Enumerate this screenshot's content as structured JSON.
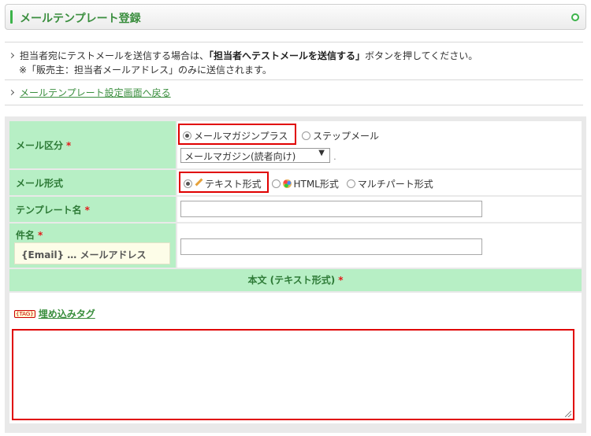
{
  "header": {
    "title": "メールテンプレート登録"
  },
  "notice": {
    "line1_pre": "担当者宛にテストメールを送信する場合は、",
    "line1_bold": "「担当者へテストメールを送信する」",
    "line1_post": "ボタンを押してください。",
    "line2": "※「販売主：担当者メールアドレス」のみに送信されます。"
  },
  "back_link": "メールテンプレート設定画面へ戻る",
  "form": {
    "mail_category": {
      "label": "メール区分",
      "required": "*",
      "options": [
        "メールマガジンプラス",
        "ステップメール"
      ],
      "selected_option": "メールマガジンプラス",
      "select_value": "メールマガジン(読者向け)",
      "trailing": "."
    },
    "mail_format": {
      "label": "メール形式",
      "options": [
        "テキスト形式",
        "HTML形式",
        "マルチパート形式"
      ],
      "selected_option": "テキスト形式"
    },
    "template_name": {
      "label": "テンプレート名",
      "required": "*",
      "value": ""
    },
    "subject": {
      "label": "件名",
      "required": "*",
      "hint": "{Email} … メールアドレス",
      "value": ""
    },
    "body_section": {
      "label": "本文 (テキスト形式)",
      "required": "*"
    },
    "embed_tag": {
      "icon_text": "{TAG}",
      "link_text": "埋め込みタグ"
    },
    "body_value": ""
  },
  "colors": {
    "accent": "#3cb34a",
    "label_bg": "#b7efc5",
    "required": "#e31b1b",
    "highlight": "#e00000"
  }
}
